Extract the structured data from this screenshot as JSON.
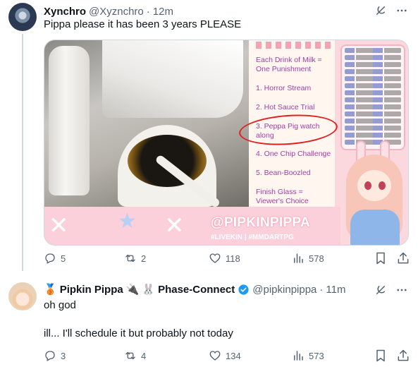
{
  "tweets": [
    {
      "author": {
        "name": "Xynchro",
        "handle": "@Xyznchro",
        "time": "12m"
      },
      "text": "Pippa please it has been 3 years PLEASE",
      "media": {
        "punishment_list": [
          "Each Drink of Milk =",
          "One Punishment",
          "1. Horror Stream",
          "2. Hot Sauce Trial",
          "3. Peppa Pig watch",
          "along",
          "4. One Chip Challenge",
          "5. Bean-Boozled",
          "Finish Glass =",
          "Viewer's Choice"
        ],
        "brand": "@PIPKINPIPPA",
        "tags": "#LIVEKIN | #MMDARTPG"
      },
      "stats": {
        "replies": "5",
        "reposts": "2",
        "likes": "118",
        "views": "578"
      }
    },
    {
      "author": {
        "name": "Pipkin Pippa",
        "name_suffix": "Phase-Connect",
        "handle": "@pipkinpippa",
        "time": "11m"
      },
      "lines": [
        "oh god",
        "ill... I'll schedule it but probably not today"
      ],
      "stats": {
        "replies": "3",
        "reposts": "4",
        "likes": "134",
        "views": "573"
      }
    }
  ],
  "icons": {
    "grok": "grok-icon",
    "more": "more-icon",
    "reply": "reply-icon",
    "repost": "repost-icon",
    "like": "heart-icon",
    "views": "views-icon",
    "bookmark": "bookmark-icon",
    "share": "share-icon"
  },
  "colors": {
    "verified": "#1d9bf0",
    "muted": "#536471",
    "text": "#0f1419",
    "list_purple": "#a03ea8",
    "banner_pink": "#fbd0da"
  }
}
